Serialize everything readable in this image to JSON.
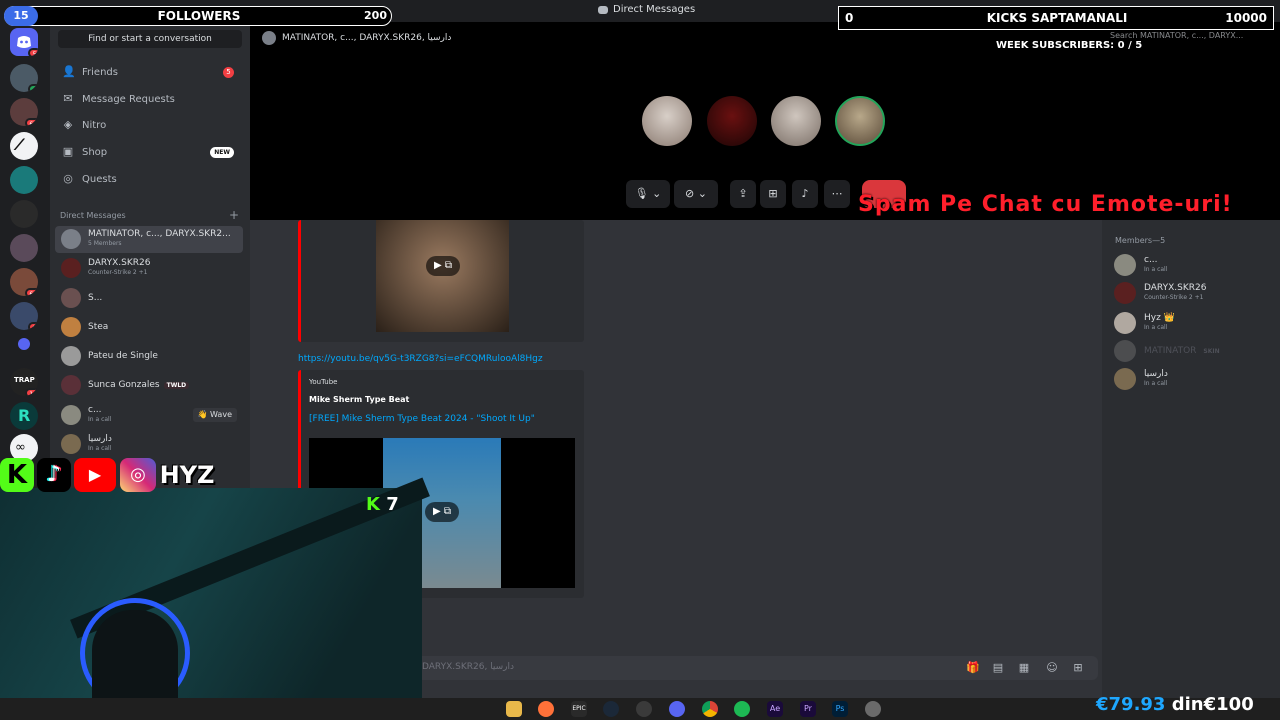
{
  "window": {
    "title": "Direct Messages"
  },
  "overlay": {
    "followers": {
      "current": "15",
      "label": "FOLLOWERS",
      "goal": "200"
    },
    "kicks": {
      "current": "0",
      "label": "KICKS SAPTAMANALI",
      "goal": "10000"
    },
    "week_subs": "WEEK SUBSCRIBERS: 0 / 5",
    "spam_banner": "Spam Pe Chat cu Emote-uri!",
    "social_handle": "HYZ",
    "kick_count": "7",
    "donation": {
      "current": "€79.93",
      "sep": "din",
      "goal": "€100"
    }
  },
  "servers": [
    {
      "badge": "5"
    },
    {
      "badge": "4"
    },
    {
      "badge": "62"
    },
    {
      "badge": ""
    },
    {
      "badge": ""
    },
    {
      "badge": ""
    },
    {
      "badge": ""
    },
    {
      "badge": "68"
    },
    {
      "badge": "8"
    },
    {
      "badge": ""
    },
    {
      "badge": "16"
    },
    {
      "badge": ""
    },
    {
      "badge": ""
    }
  ],
  "sidebar": {
    "find": "Find or start a conversation",
    "nav": [
      {
        "label": "Friends",
        "badge": "5"
      },
      {
        "label": "Message Requests"
      },
      {
        "label": "Nitro"
      },
      {
        "label": "Shop",
        "badge": "NEW"
      },
      {
        "label": "Quests"
      }
    ],
    "dm_header": "Direct Messages",
    "dms": [
      {
        "name": "MATINATOR, c..., DARYX.SKR2...",
        "sub": "5 Members"
      },
      {
        "name": "DARYX.SKR26",
        "sub": "Counter-Strike 2 +1"
      },
      {
        "name": "S..."
      },
      {
        "name": "Stea"
      },
      {
        "name": "Pateu de Single"
      },
      {
        "name": "Sunca Gonzales",
        "tag": "TWLD"
      },
      {
        "name": "c...",
        "sub": "In a call",
        "action": "Wave"
      },
      {
        "name": "دارسيا",
        "sub": "In a call"
      }
    ]
  },
  "call": {
    "header": "MATINATOR, c..., DARYX.SKR26, دارسيا",
    "search_placeholder": "Search MATINATOR, c..., DARYX..."
  },
  "chat": {
    "link": "https://youtu.be/qv5G-t3RZG8?si=eFCQMRulooAl8Hgz",
    "embed": {
      "source": "YouTube",
      "author": "Mike Sherm Type Beat",
      "title": "[FREE] Mike Sherm Type Beat 2024 - \"Shoot It Up\""
    },
    "input_placeholder": "DARYX.SKR26, دارسيا"
  },
  "members": {
    "header": "Members—5",
    "list": [
      {
        "name": "c...",
        "sub": "In a call"
      },
      {
        "name": "DARYX.SKR26",
        "sub": "Counter-Strike 2 +1"
      },
      {
        "name": "Hyz 👑",
        "sub": "In a call"
      },
      {
        "name": "MATINATOR",
        "tag": "SKIN",
        "offline": true
      },
      {
        "name": "دارسيا",
        "sub": "In a call"
      }
    ]
  },
  "colors": {
    "blurple": "#5865f2",
    "kick_green": "#53fc18",
    "danger": "#da373c",
    "spam_red": "#ff1f2b"
  }
}
